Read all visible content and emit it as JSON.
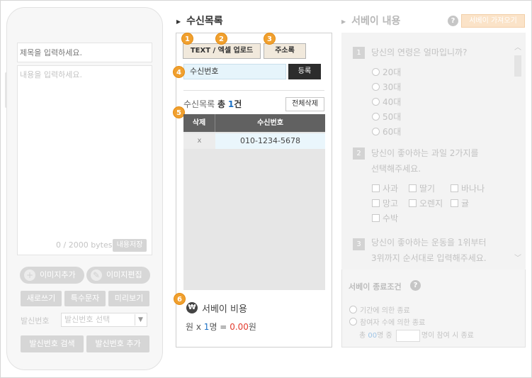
{
  "phone": {
    "subject_placeholder": "제목을 입력하세요.",
    "content_placeholder": "내용을 입력하세요.",
    "bytes": "0 / 2000 bytes",
    "save_label": "내용저장",
    "image_add": "이미지추가",
    "image_edit": "이미지편집",
    "new_write": "새로쓰기",
    "special_chars": "특수문자",
    "preview": "미리보기",
    "sender_label": "발신번호",
    "sender_select": "발신번호 선택",
    "sender_search": "발신번호 검색",
    "sender_add": "발신번호 추가"
  },
  "recipients": {
    "title": "수신목록",
    "badges": [
      "1",
      "2",
      "3",
      "4",
      "5",
      "6"
    ],
    "text_excel_upload": "TEXT / 엑셀 업로드",
    "address_book": "주소록",
    "number_placeholder": "수신번호",
    "register": "등록",
    "count_prefix": "수신목록",
    "count_total": "총",
    "count_value": "1",
    "count_suffix": "건",
    "delete_all": "전체삭제",
    "col_delete": "삭제",
    "col_number": "수신번호",
    "rows": [
      {
        "delete": "x",
        "number": "010-1234-5678"
      }
    ],
    "cost_icon": "₩",
    "cost_title": "서베이 비용",
    "cost_won": "원 x",
    "cost_count": "1",
    "cost_person": "명 =",
    "cost_amount": "0.00",
    "cost_unit": "원"
  },
  "survey": {
    "title": "서베이 내용",
    "fetch_label": "서베이 가져오기",
    "questions": [
      {
        "num": "1",
        "text": "당신의 연령은 얼마입니까?",
        "options": [
          "20대",
          "30대",
          "40대",
          "50대",
          "60대"
        ]
      },
      {
        "num": "2",
        "text_line1": "당신이 좋아하는 과일 2가지를",
        "text_line2": "선택해주세요.",
        "options": [
          "사과",
          "딸기",
          "바나나",
          "망고",
          "오렌지",
          "귤",
          "수박"
        ]
      },
      {
        "num": "3",
        "text_line1": "당신이 좋아하는 운동을 1위부터",
        "text_line2": "3위까지 순서대로 입력해주세요."
      }
    ],
    "end_title": "서베이 종료조건",
    "end_by_period": "기간에 의한 종료",
    "end_by_participants": "참여자 수에 의한 종료",
    "end_total": "총",
    "end_total_value": "00",
    "end_mid": "명 중",
    "end_suffix": "명이 참여 시 종료"
  },
  "colors": {
    "badge": "#f0a02f",
    "blue": "#1b6fc3",
    "red": "#e23b2e"
  }
}
